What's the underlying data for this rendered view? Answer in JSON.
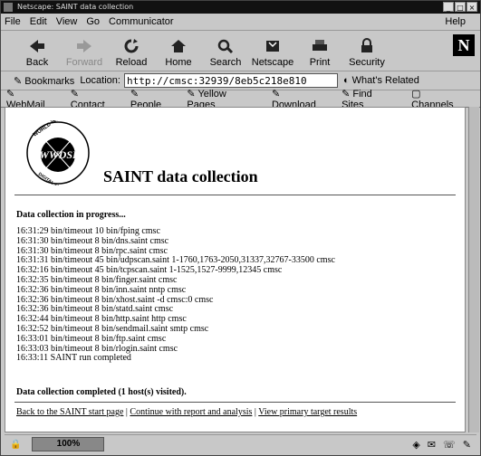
{
  "window": {
    "title": "Netscape: SAINT data collection"
  },
  "menu": [
    "File",
    "Edit",
    "View",
    "Go",
    "Communicator"
  ],
  "menu_help": "Help",
  "toolbar": [
    {
      "label": "Back",
      "icon": "back-icon",
      "enabled": true
    },
    {
      "label": "Forward",
      "icon": "forward-icon",
      "enabled": false
    },
    {
      "label": "Reload",
      "icon": "reload-icon",
      "enabled": true
    },
    {
      "label": "Home",
      "icon": "home-icon",
      "enabled": true
    },
    {
      "label": "Search",
      "icon": "search-icon",
      "enabled": true
    },
    {
      "label": "Netscape",
      "icon": "netscape-icon",
      "enabled": true
    },
    {
      "label": "Print",
      "icon": "print-icon",
      "enabled": true
    },
    {
      "label": "Security",
      "icon": "security-icon",
      "enabled": true
    }
  ],
  "logo_letter": "N",
  "location": {
    "bookmarks": "Bookmarks",
    "label": "Location:",
    "url": "http://cmsc:32939/8eb5c218e810",
    "related": "What's Related"
  },
  "personal": [
    "WebMail",
    "Contact",
    "People",
    "Yellow Pages",
    "Download",
    "Find Sites",
    "Channels"
  ],
  "page": {
    "logo_text": "WORLD WIDE · WWDSI · DIGITAL SECURITY",
    "heading": "SAINT data collection",
    "progress": "Data collection in progress...",
    "log": [
      "16:31:29 bin/timeout 10 bin/fping cmsc",
      "16:31:30 bin/timeout 8 bin/dns.saint cmsc",
      "16:31:30 bin/timeout 8 bin/rpc.saint cmsc",
      "16:31:31 bin/timeout 45 bin/udpscan.saint 1-1760,1763-2050,31337,32767-33500 cmsc",
      "16:32:16 bin/timeout 45 bin/tcpscan.saint 1-1525,1527-9999,12345 cmsc",
      "16:32:35 bin/timeout 8 bin/finger.saint cmsc",
      "16:32:36 bin/timeout 8 bin/inn.saint nntp cmsc",
      "16:32:36 bin/timeout 8 bin/xhost.saint -d cmsc:0 cmsc",
      "16:32:36 bin/timeout 8 bin/statd.saint cmsc",
      "16:32:44 bin/timeout 8 bin/http.saint http cmsc",
      "16:32:52 bin/timeout 8 bin/sendmail.saint smtp cmsc",
      "16:33:01 bin/timeout 8 bin/ftp.saint cmsc",
      "16:33:03 bin/timeout 8 bin/rlogin.saint cmsc",
      "16:33:11 SAINT run completed"
    ],
    "done": "Data collection completed (1 host(s) visited).",
    "links": [
      "Back to the SAINT start page",
      "Continue with report and analysis",
      "View primary target results"
    ],
    "separator": " | "
  },
  "status": {
    "percent": "100%"
  }
}
